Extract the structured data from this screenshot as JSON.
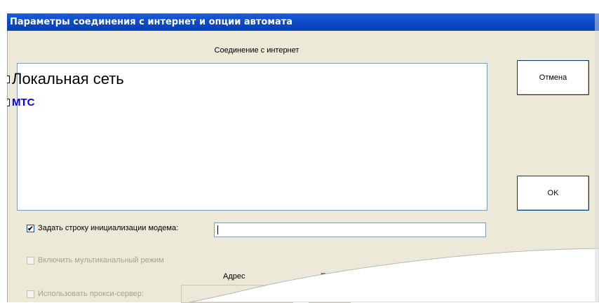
{
  "window": {
    "title": "Параметры соединения с интернет и опции автомата"
  },
  "connection": {
    "group_label": "Соединение с интернет",
    "items": [
      {
        "label": "Локальная сеть",
        "checked": false
      },
      {
        "label": "МТС",
        "checked": true
      }
    ]
  },
  "buttons": {
    "cancel": "Отмена",
    "ok": "OK"
  },
  "modem_init": {
    "label": "Задать строку инициализации модема:",
    "checked": true,
    "value": ""
  },
  "multichannel": {
    "label": "Включить мультиканальный режим",
    "enabled": false
  },
  "proxy": {
    "label": "Использовать прокси-сервер:",
    "address_label": "Адрес",
    "port_label": "Порт",
    "enabled": false
  },
  "icons": {
    "checked_mark": "☑",
    "unchecked_mark": "☐",
    "checkbox_tick": "✔"
  },
  "colors": {
    "titlebar": "#0a49c4",
    "selected_item": "#0000ee",
    "disabled_text": "#a3a295",
    "window_bg": "#ece9d8"
  }
}
